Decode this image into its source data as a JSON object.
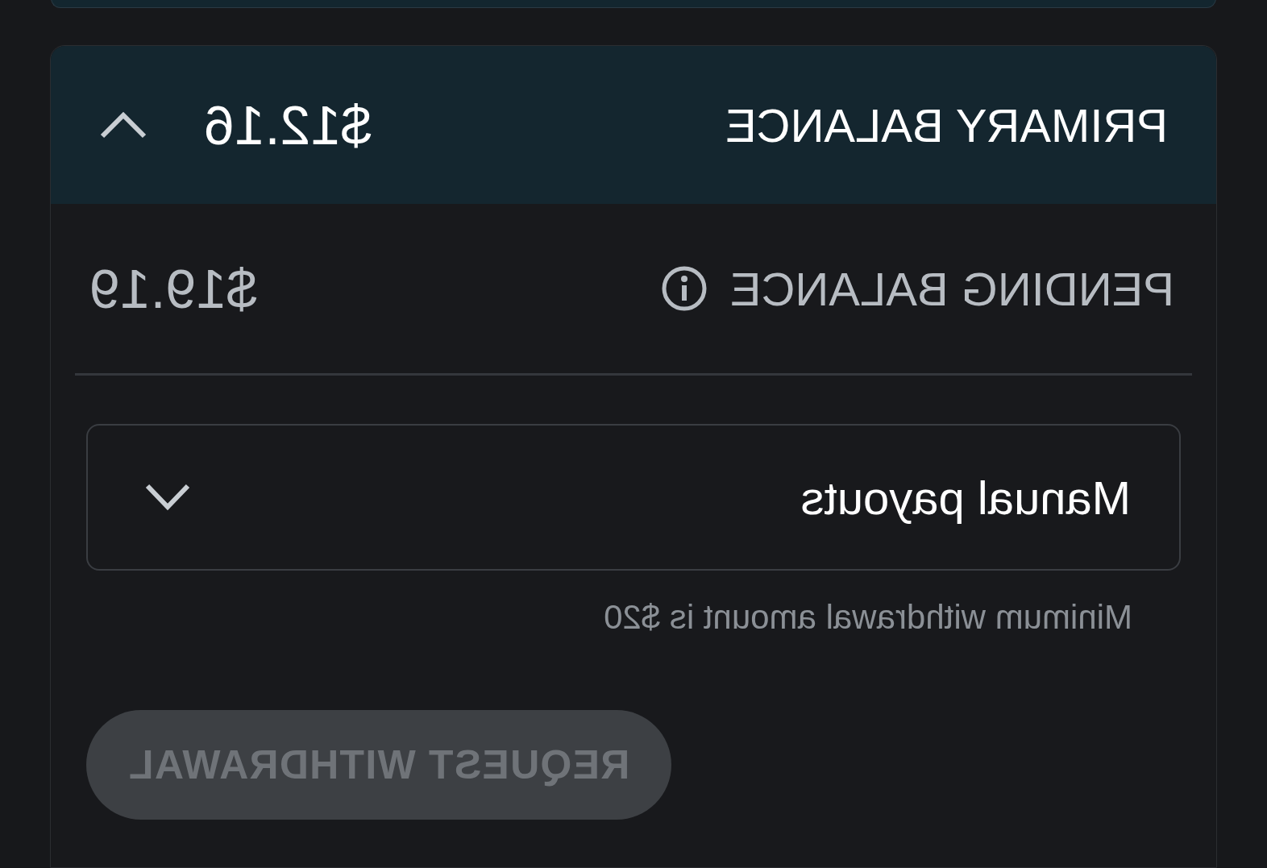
{
  "primary_balance": {
    "label": "PRIMARY BALANCE",
    "amount": "$12.16",
    "expanded": true
  },
  "pending_balance": {
    "label": "PENDING BALANCE",
    "amount": "$19.19"
  },
  "payout_select": {
    "value": "Manual payouts",
    "hint": "Minimum withdrawal amount is $20"
  },
  "withdraw_button": {
    "label": "REQUEST WITHDRAWAL",
    "disabled": true
  }
}
